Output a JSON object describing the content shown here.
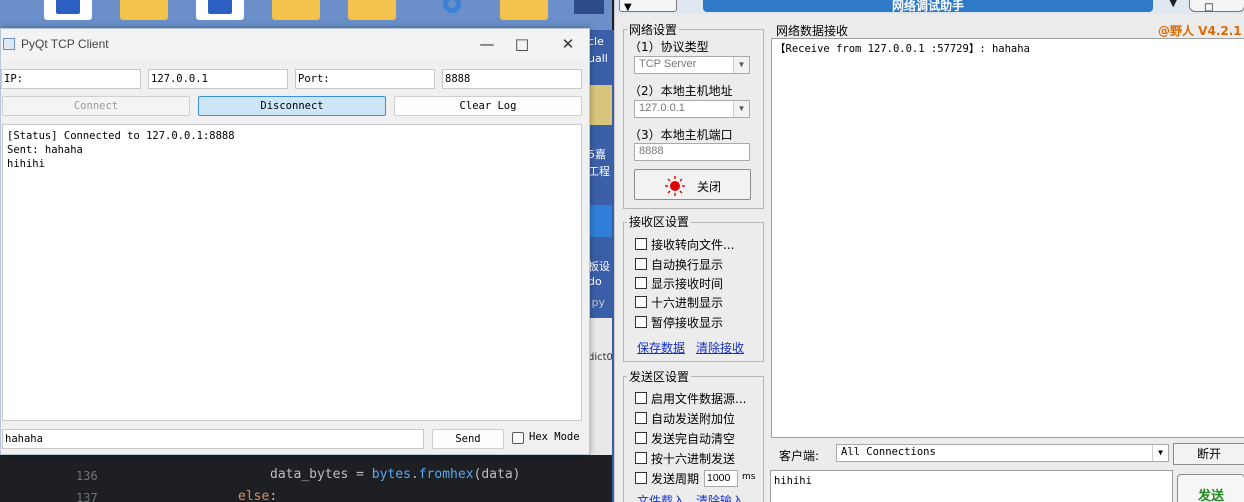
{
  "desktop": {
    "side_labels": [
      "cle",
      "uall",
      "5嘉",
      "工程",
      "板设",
      "do",
      ".py",
      "dict0"
    ]
  },
  "ide": {
    "lines": [
      {
        "number": "136",
        "code_var": "data_bytes",
        "code_op": " = ",
        "code_obj": "bytes",
        "code_dot": ".",
        "code_fn": "fromhex",
        "code_args": "(data)"
      },
      {
        "number": "137",
        "code_kw": "else",
        "code_rest": ":"
      }
    ]
  },
  "pyqt": {
    "title": "PyQt TCP Client",
    "ip_label": "IP:",
    "ip_value": "127.0.0.1",
    "port_label": "Port:",
    "port_value": "8888",
    "connect_label": "Connect",
    "disconnect_label": "Disconnect",
    "clear_label": "Clear Log",
    "log": [
      "[Status] Connected to 127.0.0.1:8888",
      "Sent: hahaha",
      "hihihi"
    ],
    "message_value": "hahaha",
    "send_label": "Send",
    "hex_label": "Hex Mode"
  },
  "net": {
    "title_band": "网络调试助手",
    "top_right_btn": "□",
    "brand": "@野人 V4.2.1",
    "settings_title": "网络设置",
    "protocol_label": "（1）协议类型",
    "protocol_value": "TCP Server",
    "host_label": "（2）本地主机地址",
    "host_value": "127.0.0.1",
    "port_label": "（3）本地主机端口",
    "port_value": "8888",
    "close_label": "关闭",
    "recv_settings_title": "接收区设置",
    "recv_options": [
      "接收转向文件...",
      "自动换行显示",
      "显示接收时间",
      "十六进制显示",
      "暂停接收显示"
    ],
    "save_link": "保存数据",
    "clear_link": "清除接收",
    "send_settings_title": "发送区设置",
    "send_options": [
      "启用文件数据源...",
      "自动发送附加位",
      "发送完自动清空",
      "按十六进制发送"
    ],
    "period_label": "发送周期",
    "period_value": "1000",
    "period_unit": "ms",
    "file_link": "文件载入",
    "clear_input_link": "清除输入",
    "recv_panel_title": "网络数据接收",
    "recv_text": "【Receive from 127.0.0.1 :57729】: hahaha",
    "client_label": "客户端:",
    "client_value": "All Connections",
    "disconnect_label": "断开",
    "send_text": "hihihi",
    "send_label": "发送"
  },
  "colors": {
    "accent_blue": "#3c8fd9",
    "brand_orange": "#e06a00",
    "title_band": "#2f79c9",
    "send_green": "#1f8a1f",
    "link_blue": "#1530c8",
    "close_red": "#e00000"
  }
}
